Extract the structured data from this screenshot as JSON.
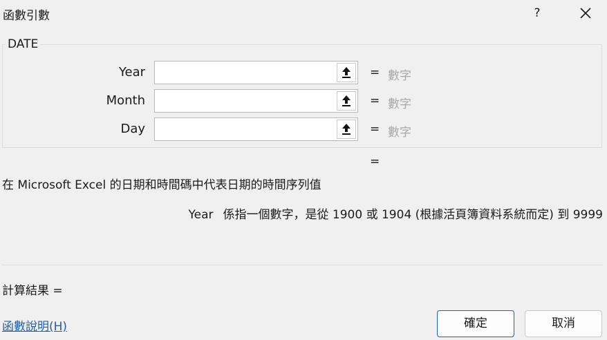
{
  "window": {
    "title": "函數引數",
    "help_label": "?"
  },
  "function": {
    "name": "DATE",
    "args": [
      {
        "label": "Year",
        "value": "",
        "hint": "數字"
      },
      {
        "label": "Month",
        "value": "",
        "hint": "數字"
      },
      {
        "label": "Day",
        "value": "",
        "hint": "數字"
      }
    ],
    "equals": "=",
    "description": "在 Microsoft Excel 的日期和時間碼中代表日期的時間序列值",
    "arg_description": {
      "name": "Year",
      "text": "係指一個數字，是從 1900 或 1904 (根據活頁簿資料系統而定) 到 9999"
    }
  },
  "result": {
    "label": "計算結果 ="
  },
  "footer": {
    "help_link": "函數說明(H)",
    "ok": "確定",
    "cancel": "取消"
  }
}
